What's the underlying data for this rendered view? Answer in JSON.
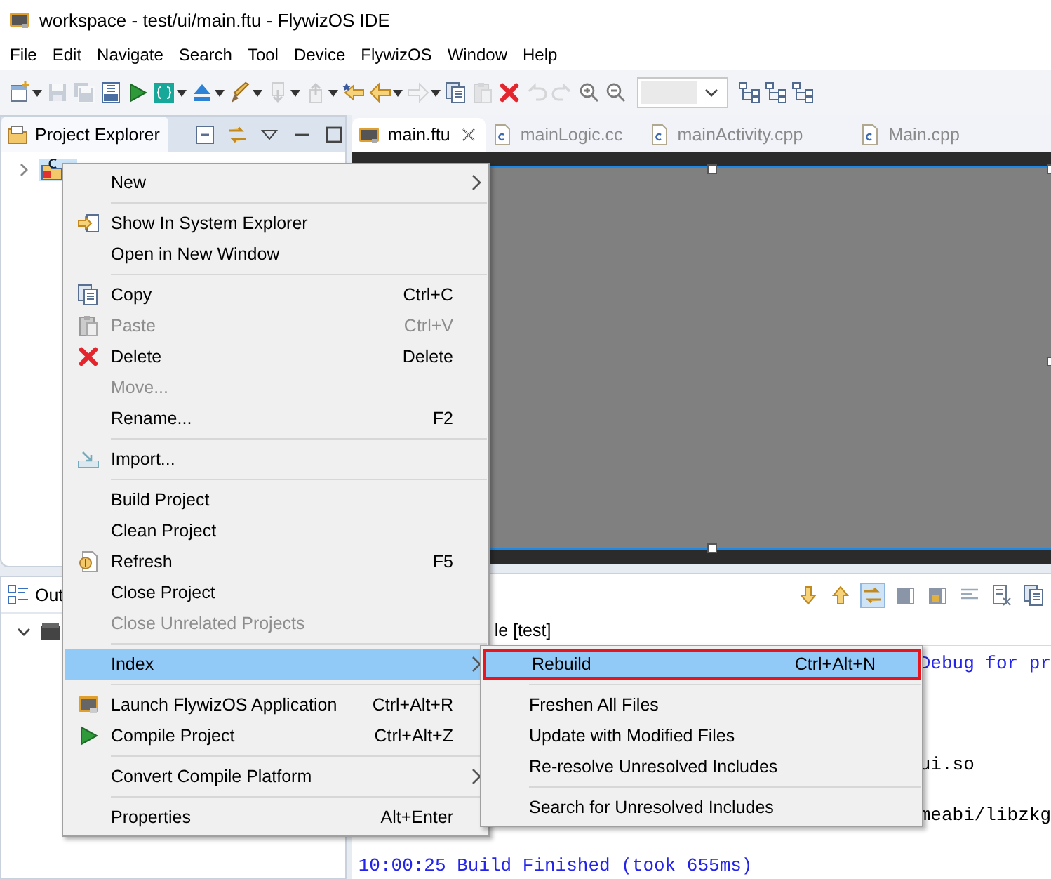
{
  "window": {
    "title": "workspace - test/ui/main.ftu - FlywizOS IDE"
  },
  "menubar": [
    "File",
    "Edit",
    "Navigate",
    "Search",
    "Tool",
    "Device",
    "FlywizOS",
    "Window",
    "Help"
  ],
  "toolbar": [
    {
      "disabled": false,
      "dropdown": true
    },
    {
      "disabled": true,
      "dropdown": false
    },
    {
      "disabled": true,
      "dropdown": false
    },
    {
      "disabled": false,
      "dropdown": false
    },
    {
      "disabled": false,
      "dropdown": false
    },
    {
      "disabled": false,
      "dropdown": true
    },
    {
      "disabled": false,
      "dropdown": true
    },
    {
      "disabled": false,
      "dropdown": true
    },
    {
      "disabled": true,
      "dropdown": true
    },
    {
      "disabled": true,
      "dropdown": true
    },
    {
      "disabled": false,
      "dropdown": false
    },
    {
      "disabled": false,
      "dropdown": true
    },
    {
      "disabled": true,
      "dropdown": true
    },
    {
      "disabled": false,
      "dropdown": false
    },
    {
      "disabled": true,
      "dropdown": false
    },
    {
      "disabled": false,
      "dropdown": false
    },
    {
      "disabled": true,
      "dropdown": false
    },
    {
      "disabled": true,
      "dropdown": false
    },
    {
      "disabled": false,
      "dropdown": false
    },
    {
      "disabled": false,
      "dropdown": false
    }
  ],
  "explorer": {
    "tab": {
      "label": "Project Explorer",
      "selected": true
    },
    "tree": [
      {
        "expanded": false,
        "selected": true
      }
    ]
  },
  "outline": {
    "tab": {
      "label": "Out"
    },
    "tree": [
      {
        "expanded": true
      }
    ]
  },
  "editor_tabs": [
    {
      "label": "main.ftu",
      "selected": true
    },
    {
      "label": "mainLogic.cc",
      "selected": false
    },
    {
      "label": "mainActivity.cpp",
      "selected": false
    },
    {
      "label": "Main.cpp",
      "selected": false
    }
  ],
  "console": {
    "header": "le [test]",
    "lines": [
      {
        "text": "Debug for pr",
        "kind": "clipped",
        "color": "#2424e8"
      },
      {
        "text": "ui.so",
        "kind": "clipped",
        "color": "#000000"
      },
      {
        "text": "meabi/libzkg",
        "kind": "clipped",
        "color": "#000000"
      },
      {
        "text": "10:00:25 Build Finished (took 655ms)",
        "kind": "full",
        "color": "#2424e8"
      }
    ]
  },
  "context_menu": {
    "groups": [
      [
        {
          "label": "New",
          "submenu": true,
          "disabled": false,
          "selected": false
        }
      ],
      [
        {
          "label": "Show In System Explorer",
          "submenu": false,
          "disabled": false,
          "selected": false
        },
        {
          "label": "Open in New Window",
          "submenu": false,
          "disabled": false,
          "selected": false
        }
      ],
      [
        {
          "label": "Copy",
          "shortcut": "Ctrl+C",
          "submenu": false,
          "disabled": false,
          "selected": false
        },
        {
          "label": "Paste",
          "shortcut": "Ctrl+V",
          "submenu": false,
          "disabled": true,
          "selected": false
        },
        {
          "label": "Delete",
          "shortcut": "Delete",
          "submenu": false,
          "disabled": false,
          "selected": false
        },
        {
          "label": "Move...",
          "submenu": false,
          "disabled": true,
          "selected": false
        },
        {
          "label": "Rename...",
          "shortcut": "F2",
          "submenu": false,
          "disabled": false,
          "selected": false
        }
      ],
      [
        {
          "label": "Import...",
          "submenu": false,
          "disabled": false,
          "selected": false
        }
      ],
      [
        {
          "label": "Build Project",
          "submenu": false,
          "disabled": false,
          "selected": false
        },
        {
          "label": "Clean Project",
          "submenu": false,
          "disabled": false,
          "selected": false
        },
        {
          "label": "Refresh",
          "shortcut": "F5",
          "submenu": false,
          "disabled": false,
          "selected": false
        },
        {
          "label": "Close Project",
          "submenu": false,
          "disabled": false,
          "selected": false
        },
        {
          "label": "Close Unrelated Projects",
          "submenu": false,
          "disabled": true,
          "selected": false
        }
      ],
      [
        {
          "label": "Index",
          "submenu": true,
          "disabled": false,
          "selected": true
        }
      ],
      [
        {
          "label": "Launch FlywizOS Application",
          "shortcut": "Ctrl+Alt+R",
          "submenu": false,
          "disabled": false,
          "selected": false
        },
        {
          "label": "Compile Project",
          "shortcut": "Ctrl+Alt+Z",
          "submenu": false,
          "disabled": false,
          "selected": false
        }
      ],
      [
        {
          "label": "Convert Compile Platform",
          "submenu": true,
          "disabled": false,
          "selected": false
        }
      ],
      [
        {
          "label": "Properties",
          "shortcut": "Alt+Enter",
          "submenu": false,
          "disabled": false,
          "selected": false
        }
      ]
    ]
  },
  "submenu": {
    "groups": [
      [
        {
          "label": "Rebuild",
          "shortcut": "Ctrl+Alt+N",
          "selected": true,
          "outlined": true
        }
      ],
      [
        {
          "label": "Freshen All Files",
          "selected": false,
          "outlined": false
        },
        {
          "label": "Update with Modified Files",
          "selected": false,
          "outlined": false
        },
        {
          "label": "Re-resolve Unresolved Includes",
          "selected": false,
          "outlined": false
        }
      ],
      [
        {
          "label": "Search for Unresolved Includes",
          "selected": false,
          "outlined": false
        }
      ]
    ]
  }
}
